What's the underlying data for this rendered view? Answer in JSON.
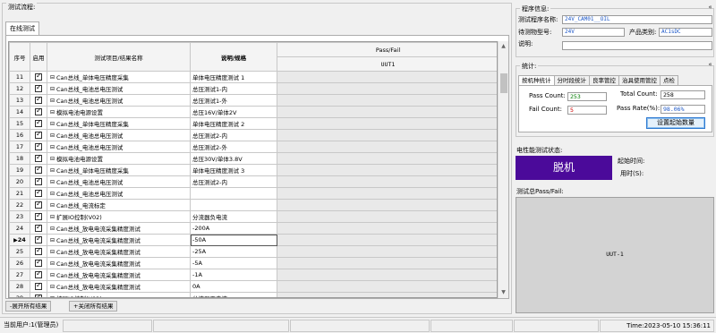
{
  "left": {
    "title": "测试流程:",
    "tab": "在线测试",
    "columns": {
      "seq": "序号",
      "enabled": "启用",
      "item": "测试项目/结果名称",
      "spec": "说明/规格",
      "passfail": "Pass/Fail",
      "uut": "UUT1"
    },
    "rows": [
      {
        "seq": "11",
        "item": "Can总线_单体电压精度采集",
        "spec": "单体电压精度测试 1"
      },
      {
        "seq": "12",
        "item": "Can总线_电池总电压测试",
        "spec": "总压测试1-内"
      },
      {
        "seq": "13",
        "item": "Can总线_电池总电压测试",
        "spec": "总压测试1-外"
      },
      {
        "seq": "14",
        "item": "模拟电池电源设置",
        "spec": "总压16V/单体2V"
      },
      {
        "seq": "15",
        "item": "Can总线_单体电压精度采集",
        "spec": "单体电压精度测试 2"
      },
      {
        "seq": "16",
        "item": "Can总线_电池总电压测试",
        "spec": "总压测试2-内"
      },
      {
        "seq": "17",
        "item": "Can总线_电池总电压测试",
        "spec": "总压测试2-外"
      },
      {
        "seq": "18",
        "item": "模拟电池电源设置",
        "spec": "总压30V/单体3.8V"
      },
      {
        "seq": "19",
        "item": "Can总线_单体电压精度采集",
        "spec": "单体电压精度测试 3"
      },
      {
        "seq": "20",
        "item": "Can总线_电池总电压测试",
        "spec": "总压测试2-内"
      },
      {
        "seq": "21",
        "item": "Can总线_电池总电压测试",
        "spec": ""
      },
      {
        "seq": "22",
        "item": "Can总线_电流标定",
        "spec": ""
      },
      {
        "seq": "23",
        "item": "扩展IO控制(V02)",
        "spec": "分流器负电流"
      },
      {
        "seq": "24",
        "item": "Can总线_放电电流采集精度测试",
        "spec": "-200A"
      },
      {
        "seq": "24",
        "item": "Can总线_放电电流采集精度测试",
        "spec": "-50A"
      },
      {
        "seq": "25",
        "item": "Can总线_放电电流采集精度测试",
        "spec": "-25A"
      },
      {
        "seq": "26",
        "item": "Can总线_放电电流采集精度测试",
        "spec": "-5A"
      },
      {
        "seq": "27",
        "item": "Can总线_放电电流采集精度测试",
        "spec": "-1A"
      },
      {
        "seq": "28",
        "item": "Can总线_放电电流采集精度测试",
        "spec": "0A"
      },
      {
        "seq": "29",
        "item": "扩展IO控制(V02)",
        "spec": "分流器正电流"
      }
    ],
    "current_row_marker": "▶",
    "expand_box": "⊟",
    "expand_all": "-展开所有结果",
    "collapse_all": "+关闭所有结果"
  },
  "program": {
    "title": "程序信息:",
    "name_label": "测试程序名称:",
    "name_value": "24V_CAM01__OIL",
    "part_label": "待测物型号:",
    "part_value": "24V",
    "category_label": "产品类别:",
    "category_value": "AC1sDC",
    "desc_label": "说明:",
    "desc_value": ""
  },
  "stats": {
    "title": "统计:",
    "tabs": [
      "按机种统计",
      "分时段统计",
      "良率管控",
      "治具使用管控",
      "点检"
    ],
    "pass_count_label": "Pass Count:",
    "pass_count": "253",
    "total_count_label": "Total Count:",
    "total_count": "258",
    "fail_count_label": "Fail Count:",
    "fail_count": "5",
    "pass_rate_label": "Pass Rate(%):",
    "pass_rate": "98.06%",
    "set_start_button": "设置起始数量"
  },
  "perf": {
    "title": "电性能测试状态:",
    "status": "脱机",
    "start_time_label": "起始时间:",
    "elapsed_label": "用时(S):"
  },
  "result": {
    "title": "测试总Pass/Fail:",
    "uut": "UUT-1"
  },
  "statusbar": {
    "user": "当前用户:1(管理员)",
    "time": "Time:2023-05-10 15:36:11"
  },
  "colors": {
    "offline_bg": "#4b0a9a",
    "value_blue": "#1e58c8",
    "pass_green": "#007a00",
    "fail_red": "#d00000"
  }
}
